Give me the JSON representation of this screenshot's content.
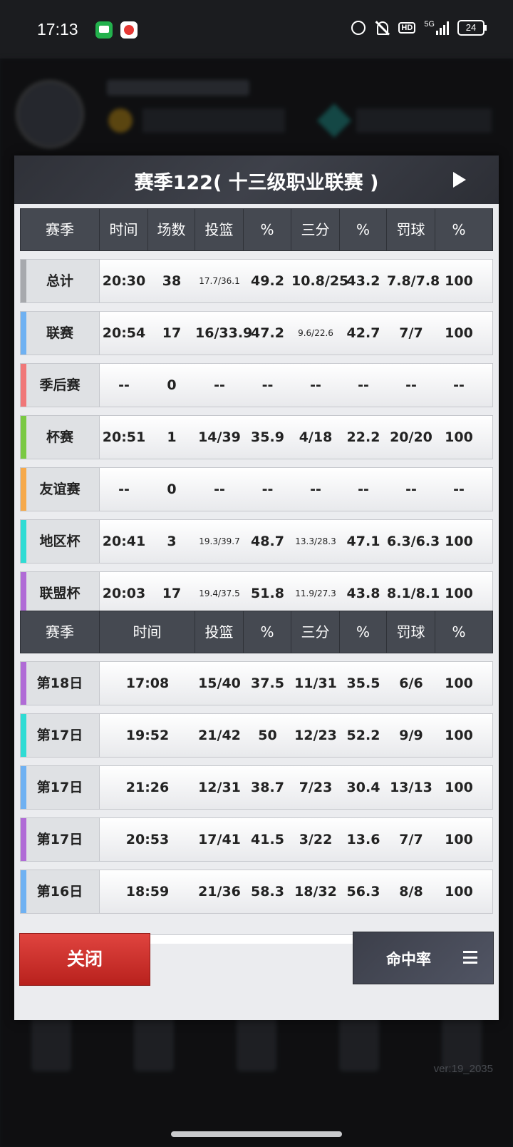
{
  "status_bar": {
    "time": "17:13",
    "network": "5G",
    "hd": "HD",
    "battery": "24"
  },
  "background": {
    "version": "ver:19_2035"
  },
  "modal": {
    "title": "赛季122( 十三级职业联赛 )",
    "summary_headers": [
      "赛季",
      "时间",
      "场数",
      "投篮",
      "%",
      "三分",
      "%",
      "罚球",
      "%"
    ],
    "summary_rows": [
      {
        "name": "总计",
        "stripe": "#a7a9ad",
        "time": "20:30",
        "games": "38",
        "fg": "17.7/36.1",
        "fg_pct": "49.2",
        "three": "10.8/25",
        "three_pct": "43.2",
        "ft": "7.8/7.8",
        "ft_pct": "100"
      },
      {
        "name": "联赛",
        "stripe": "#6fb1f2",
        "time": "20:54",
        "games": "17",
        "fg": "16/33.9",
        "fg_pct": "47.2",
        "three": "9.6/22.6",
        "three_pct": "42.7",
        "ft": "7/7",
        "ft_pct": "100"
      },
      {
        "name": "季后赛",
        "stripe": "#f07778",
        "time": "--",
        "games": "0",
        "fg": "--",
        "fg_pct": "--",
        "three": "--",
        "three_pct": "--",
        "ft": "--",
        "ft_pct": "--"
      },
      {
        "name": "杯赛",
        "stripe": "#7ac943",
        "time": "20:51",
        "games": "1",
        "fg": "14/39",
        "fg_pct": "35.9",
        "three": "4/18",
        "three_pct": "22.2",
        "ft": "20/20",
        "ft_pct": "100"
      },
      {
        "name": "友谊赛",
        "stripe": "#f6a94a",
        "time": "--",
        "games": "0",
        "fg": "--",
        "fg_pct": "--",
        "three": "--",
        "three_pct": "--",
        "ft": "--",
        "ft_pct": "--"
      },
      {
        "name": "地区杯",
        "stripe": "#2fdcd4",
        "time": "20:41",
        "games": "3",
        "fg": "19.3/39.7",
        "fg_pct": "48.7",
        "three": "13.3/28.3",
        "three_pct": "47.1",
        "ft": "6.3/6.3",
        "ft_pct": "100"
      },
      {
        "name": "联盟杯",
        "stripe": "#b06bd6",
        "time": "20:03",
        "games": "17",
        "fg": "19.4/37.5",
        "fg_pct": "51.8",
        "three": "11.9/27.3",
        "three_pct": "43.8",
        "ft": "8.1/8.1",
        "ft_pct": "100"
      }
    ],
    "games_headers": [
      "赛季",
      "时间",
      "投篮",
      "%",
      "三分",
      "%",
      "罚球",
      "%"
    ],
    "game_rows": [
      {
        "day": "第18日",
        "stripe": "#b06bd6",
        "time": "17:08",
        "fg": "15/40",
        "fg_pct": "37.5",
        "three": "11/31",
        "three_pct": "35.5",
        "ft": "6/6",
        "ft_pct": "100"
      },
      {
        "day": "第17日",
        "stripe": "#2fdcd4",
        "time": "19:52",
        "fg": "21/42",
        "fg_pct": "50",
        "three": "12/23",
        "three_pct": "52.2",
        "ft": "9/9",
        "ft_pct": "100"
      },
      {
        "day": "第17日",
        "stripe": "#6fb1f2",
        "time": "21:26",
        "fg": "12/31",
        "fg_pct": "38.7",
        "three": "7/23",
        "three_pct": "30.4",
        "ft": "13/13",
        "ft_pct": "100"
      },
      {
        "day": "第17日",
        "stripe": "#b06bd6",
        "time": "20:53",
        "fg": "17/41",
        "fg_pct": "41.5",
        "three": "3/22",
        "three_pct": "13.6",
        "ft": "7/7",
        "ft_pct": "100"
      },
      {
        "day": "第16日",
        "stripe": "#6fb1f2",
        "time": "18:59",
        "fg": "21/36",
        "fg_pct": "58.3",
        "three": "18/32",
        "three_pct": "56.3",
        "ft": "8/8",
        "ft_pct": "100"
      }
    ],
    "close_label": "关闭",
    "rate_label": "命中率"
  }
}
